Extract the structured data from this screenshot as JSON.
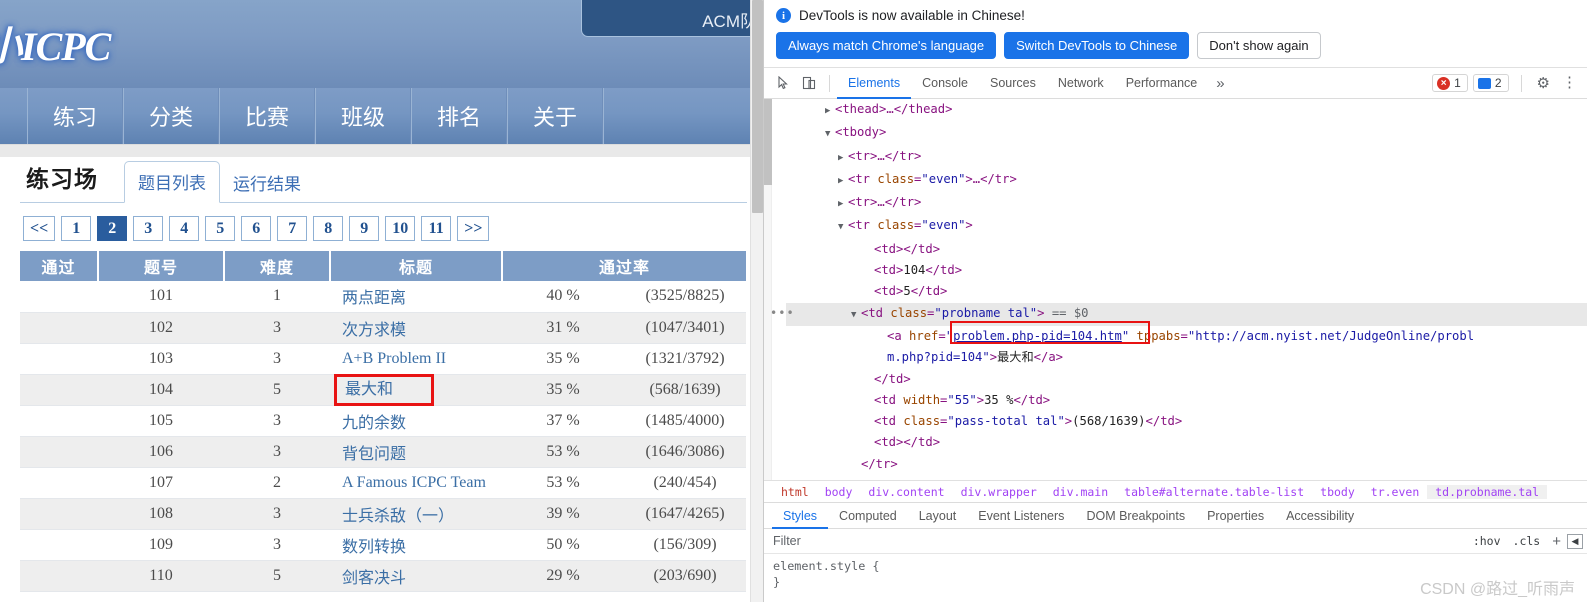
{
  "webpage": {
    "logo_text": "小ICPC",
    "user_tab": "ACM队",
    "nav": [
      {
        "label": "练习"
      },
      {
        "label": "分类"
      },
      {
        "label": "比赛"
      },
      {
        "label": "班级"
      },
      {
        "label": "排名"
      },
      {
        "label": "关于"
      }
    ],
    "section_title": "练习场",
    "sub_tabs": [
      {
        "label": "题目列表",
        "active": true
      },
      {
        "label": "运行结果",
        "active": false
      }
    ],
    "pagination": {
      "prev": "<<",
      "next": ">>",
      "pages": [
        "1",
        "2",
        "3",
        "4",
        "5",
        "6",
        "7",
        "8",
        "9",
        "10",
        "11"
      ],
      "current": "2"
    },
    "table": {
      "headers": [
        "通过",
        "题号",
        "难度",
        "标题",
        "通过率"
      ],
      "rows": [
        {
          "pass": "",
          "id": "101",
          "difficulty": "1",
          "title": "两点距离",
          "rate": "40 %",
          "total": "(3525/8825)",
          "highlight": false
        },
        {
          "pass": "",
          "id": "102",
          "difficulty": "3",
          "title": "次方求模",
          "rate": "31 %",
          "total": "(1047/3401)",
          "highlight": false
        },
        {
          "pass": "",
          "id": "103",
          "difficulty": "3",
          "title": "A+B Problem II",
          "rate": "35 %",
          "total": "(1321/3792)",
          "highlight": false
        },
        {
          "pass": "",
          "id": "104",
          "difficulty": "5",
          "title": "最大和",
          "rate": "35 %",
          "total": "(568/1639)",
          "highlight": true
        },
        {
          "pass": "",
          "id": "105",
          "difficulty": "3",
          "title": "九的余数",
          "rate": "37 %",
          "total": "(1485/4000)",
          "highlight": false
        },
        {
          "pass": "",
          "id": "106",
          "difficulty": "3",
          "title": "背包问题",
          "rate": "53 %",
          "total": "(1646/3086)",
          "highlight": false
        },
        {
          "pass": "",
          "id": "107",
          "difficulty": "2",
          "title": "A Famous ICPC Team",
          "rate": "53 %",
          "total": "(240/454)",
          "highlight": false
        },
        {
          "pass": "",
          "id": "108",
          "difficulty": "3",
          "title": "士兵杀敌（一）",
          "rate": "39 %",
          "total": "(1647/4265)",
          "highlight": false
        },
        {
          "pass": "",
          "id": "109",
          "difficulty": "3",
          "title": "数列转换",
          "rate": "50 %",
          "total": "(156/309)",
          "highlight": false
        },
        {
          "pass": "",
          "id": "110",
          "difficulty": "5",
          "title": "剑客决斗",
          "rate": "29 %",
          "total": "(203/690)",
          "highlight": false
        }
      ]
    }
  },
  "devtools": {
    "banner": {
      "message": "DevTools is now available in Chinese!",
      "info_icon": "info-icon",
      "buttons": [
        {
          "label": "Always match Chrome's language",
          "style": "primary"
        },
        {
          "label": "Switch DevTools to Chinese",
          "style": "primary"
        },
        {
          "label": "Don't show again",
          "style": "plain"
        }
      ]
    },
    "toolbar": {
      "inspect_icon": "inspect-cursor-icon",
      "device_icon": "device-toolbar-icon",
      "tabs": [
        {
          "label": "Elements",
          "active": true
        },
        {
          "label": "Console",
          "active": false
        },
        {
          "label": "Sources",
          "active": false
        },
        {
          "label": "Network",
          "active": false
        },
        {
          "label": "Performance",
          "active": false
        }
      ],
      "more_tabs": "»",
      "error_count": "1",
      "message_count": "2",
      "settings_icon": "gear-icon",
      "menu_icon": "kebab-menu-icon"
    },
    "dom_lines": [
      {
        "indent": 3,
        "tri": "▶",
        "html": "<span class=\"tagc\">&lt;thead&gt;</span><span class=\"ellip\">…</span><span class=\"tagc\">&lt;/thead&gt;</span>"
      },
      {
        "indent": 3,
        "tri": "▼",
        "html": "<span class=\"tagc\">&lt;tbody&gt;</span>"
      },
      {
        "indent": 4,
        "tri": "▶",
        "html": "<span class=\"tagc\">&lt;tr&gt;</span><span class=\"ellip\">…</span><span class=\"tagc\">&lt;/tr&gt;</span>"
      },
      {
        "indent": 4,
        "tri": "▶",
        "html": "<span class=\"tagc\">&lt;tr </span><span class=\"attrn\">class</span><span class=\"punc\">=</span><span class=\"attrv\">\"even\"</span><span class=\"tagc\">&gt;</span><span class=\"ellip\">…</span><span class=\"tagc\">&lt;/tr&gt;</span>"
      },
      {
        "indent": 4,
        "tri": "▶",
        "html": "<span class=\"tagc\">&lt;tr&gt;</span><span class=\"ellip\">…</span><span class=\"tagc\">&lt;/tr&gt;</span>"
      },
      {
        "indent": 4,
        "tri": "▼",
        "html": "<span class=\"tagc\">&lt;tr </span><span class=\"attrn\">class</span><span class=\"punc\">=</span><span class=\"attrv\">\"even\"</span><span class=\"tagc\">&gt;</span>"
      },
      {
        "indent": 6,
        "tri": "",
        "html": "<span class=\"tagc\">&lt;td&gt;&lt;/td&gt;</span>"
      },
      {
        "indent": 6,
        "tri": "",
        "html": "<span class=\"tagc\">&lt;td&gt;</span><span class=\"txtc\">104</span><span class=\"tagc\">&lt;/td&gt;</span>"
      },
      {
        "indent": 6,
        "tri": "",
        "html": "<span class=\"tagc\">&lt;td&gt;</span><span class=\"txtc\">5</span><span class=\"tagc\">&lt;/td&gt;</span>"
      },
      {
        "indent": 5,
        "tri": "▼",
        "selected": true,
        "html": "<span class=\"tagc\">&lt;td </span><span class=\"attrn\">class</span><span class=\"punc\">=</span><span class=\"attrv\">\"probname tal\"</span><span class=\"tagc\">&gt;</span> <span class=\"dollar\">== $0</span>"
      },
      {
        "indent": 7,
        "tri": "",
        "html": "<span class=\"tagc\">&lt;a </span><span class=\"attrn\">href</span><span class=\"punc\">=</span><span class=\"attrv\">\"</span><span class=\"link-u\">problem.php-pid=104.htm</span><span class=\"attrv\">\"</span><span class=\"tagc\"> </span><span class=\"attrn\">tppabs</span><span class=\"punc\">=</span><span class=\"attrv\">\"http://acm.nyist.net/JudgeOnline/probl</span>"
      },
      {
        "indent": 7,
        "tri": "",
        "html": "<span class=\"attrv\">m.php?pid=104\"</span><span class=\"tagc\">&gt;</span><span class=\"txtc\">最大和</span><span class=\"tagc\">&lt;/a&gt;</span>"
      },
      {
        "indent": 6,
        "tri": "",
        "html": "<span class=\"tagc\">&lt;/td&gt;</span>"
      },
      {
        "indent": 6,
        "tri": "",
        "html": "<span class=\"tagc\">&lt;td </span><span class=\"attrn\">width</span><span class=\"punc\">=</span><span class=\"attrv\">\"55\"</span><span class=\"tagc\">&gt;</span><span class=\"txtc\">35 %</span><span class=\"tagc\">&lt;/td&gt;</span>"
      },
      {
        "indent": 6,
        "tri": "",
        "html": "<span class=\"tagc\">&lt;td </span><span class=\"attrn\">class</span><span class=\"punc\">=</span><span class=\"attrv\">\"pass-total tal\"</span><span class=\"tagc\">&gt;</span><span class=\"txtc\">(568/1639)</span><span class=\"tagc\">&lt;/td&gt;</span>"
      },
      {
        "indent": 6,
        "tri": "",
        "html": "<span class=\"tagc\">&lt;td&gt;&lt;/td&gt;</span>"
      },
      {
        "indent": 5,
        "tri": "",
        "html": "<span class=\"tagc\">&lt;/tr&gt;</span>"
      }
    ],
    "breadcrumbs": [
      {
        "label": "html",
        "selected": false
      },
      {
        "label": "body",
        "selected": false
      },
      {
        "label": "div.content",
        "selected": false
      },
      {
        "label": "div.wrapper",
        "selected": false
      },
      {
        "label": "div.main",
        "selected": false
      },
      {
        "label": "table#alternate.table-list",
        "selected": false
      },
      {
        "label": "tbody",
        "selected": false
      },
      {
        "label": "tr.even",
        "selected": false
      },
      {
        "label": "td.probname.tal",
        "selected": true
      }
    ],
    "styles_tabs": [
      {
        "label": "Styles",
        "active": true
      },
      {
        "label": "Computed",
        "active": false
      },
      {
        "label": "Layout",
        "active": false
      },
      {
        "label": "Event Listeners",
        "active": false
      },
      {
        "label": "DOM Breakpoints",
        "active": false
      },
      {
        "label": "Properties",
        "active": false
      },
      {
        "label": "Accessibility",
        "active": false
      }
    ],
    "filter": {
      "placeholder": "Filter",
      "value": "",
      "hov_label": ":hov",
      "cls_label": ".cls",
      "new_rule_icon": "plus-icon",
      "computed_sidebar_icon": "panel-toggle-icon"
    },
    "css_rule": {
      "selector": "element.style {",
      "close": "}"
    },
    "watermark": "CSDN @路过_听雨声"
  },
  "colors": {
    "accent_blue": "#1a73e8",
    "site_header_blue": "#7f9cc4",
    "table_header_blue": "#7d9dc6",
    "highlight_red": "#e81313",
    "pager_active": "#2a5d9e"
  }
}
